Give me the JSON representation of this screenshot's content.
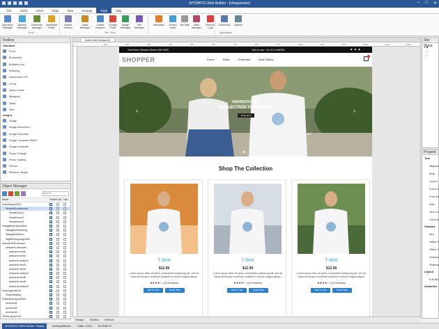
{
  "app": {
    "title": "WYSIWYG Web Builder - [shopperwire]"
  },
  "menu": [
    "File",
    "Home",
    "Insert",
    "Page",
    "View",
    "Arrange",
    "Tools",
    "Help"
  ],
  "menu_active": "Tools",
  "ribbon": {
    "buttons": [
      {
        "label": "Animation Manager",
        "color": "#5a88c6"
      },
      {
        "label": "Backup Manager",
        "color": "#4aa6d8"
      },
      {
        "label": "Extension Manager",
        "color": "#6a8a3a"
      },
      {
        "label": "JavaScript Editor",
        "color": "#d9a021"
      },
      {
        "label": "Master Frames",
        "color": "#7a7ab0"
      },
      {
        "label": "Asset Manager",
        "color": "#c98b2a"
      },
      {
        "label": "Global Replace",
        "color": "#4d88c8"
      },
      {
        "label": "Google Fonts",
        "color": "#d9463a"
      },
      {
        "label": "Image Manager",
        "color": "#3a9a5a"
      },
      {
        "label": "Link Manager",
        "color": "#7a5ab0"
      },
      {
        "label": "Inferodule",
        "color": "#e67b2a"
      },
      {
        "label": "Search Index",
        "color": "#4a9ad8"
      },
      {
        "label": "Site Map",
        "color": "#9a9a9a"
      },
      {
        "label": "Style Manager",
        "color": "#b04a6a"
      },
      {
        "label": "Remove Logo",
        "color": "#d84040"
      },
      {
        "label": "Customize",
        "color": "#5a7ab0"
      },
      {
        "label": "Options",
        "color": "#6a8a9a"
      }
    ],
    "groups": [
      "Tools",
      "Site Tools",
      "Application"
    ]
  },
  "toolbox": {
    "title": "Toolbox",
    "sections": [
      {
        "name": "Standard",
        "items": [
          "Form",
          "Bookmark",
          "Bulleted List",
          "Heading",
          "Horizontal Line",
          "HTML",
          "Inline Frame",
          "Marquee",
          "Table",
          "Text"
        ]
      },
      {
        "name": "Images",
        "items": [
          "Image",
          "Image Accordion",
          "Image Carousel",
          "Image Compare Slider",
          "Image Hotspots",
          "Photo Collage",
          "Photo Gallery",
          "Picture",
          "Rollover Image"
        ]
      }
    ]
  },
  "object_manager": {
    "title": "Object Manager",
    "search_placeholder": "Search",
    "columns": [
      "Name",
      "Visible",
      "Lock",
      "Use"
    ],
    "rows": [
      {
        "name": "IndexLayoutGrid",
        "indent": 0
      },
      {
        "name": "HeaderBreadcrumb",
        "indent": 1,
        "selected": true
      },
      {
        "name": "HeaderIcon1",
        "indent": 2
      },
      {
        "name": "HeaderIcon2",
        "indent": 2
      },
      {
        "name": "HeaderIcon3",
        "indent": 2
      },
      {
        "name": "NavigationLayoutGrid",
        "indent": 0
      },
      {
        "name": "NavigationHeading",
        "indent": 1
      },
      {
        "name": "NavigationMenu",
        "indent": 1
      },
      {
        "name": "DigitalShoppingCart1",
        "indent": 1
      },
      {
        "name": "LayoutGridCarousel",
        "indent": 0
      },
      {
        "name": "welcome-carousel",
        "indent": 1
      },
      {
        "name": "welcome-text1",
        "indent": 2
      },
      {
        "name": "welcome-text2",
        "indent": 2
      },
      {
        "name": "welcome-button1",
        "indent": 2
      },
      {
        "name": "welcome-text3",
        "indent": 2
      },
      {
        "name": "welcome-text4",
        "indent": 2
      },
      {
        "name": "welcome-button2",
        "indent": 2
      },
      {
        "name": "welcome-text5",
        "indent": 2
      },
      {
        "name": "welcome-text6",
        "indent": 2
      },
      {
        "name": "welcome-button3",
        "indent": 2
      },
      {
        "name": "ShopLayoutGrid",
        "indent": 0
      },
      {
        "name": "ShopHeading",
        "indent": 1
      },
      {
        "name": "CollectionLayoutGrid",
        "indent": 0
      },
      {
        "name": "iconCard1",
        "indent": 1
      },
      {
        "name": "iconCard2",
        "indent": 1
      },
      {
        "name": "iconCard3",
        "indent": 1
      },
      {
        "name": "TshirtLayoutGrid",
        "indent": 0
      }
    ]
  },
  "document_tab": "index.html (shopper)",
  "ruler_ticks": [
    "100",
    "200",
    "300",
    "400",
    "500",
    "600",
    "700",
    "800",
    "900",
    "1000",
    "1100",
    "1200",
    "1300",
    "1400",
    "1500"
  ],
  "website": {
    "topbar_left": "Visit Store: Meadow Street 4100 9000",
    "topbar_right": "Call us now: +44 012 4496789",
    "logo": "SHOPPER",
    "nav": [
      "Home",
      "News",
      "Collection",
      "Best Sellers"
    ],
    "hero_line1": "INSPIRATIONAL",
    "hero_line2": "COLLECTION TO SEASON",
    "hero_button": "Shop Now",
    "section_title": "Shop The Collection",
    "products": [
      {
        "name": "T-Shirt",
        "price": "$12.99",
        "desc": "Lorem ipsum dolor sit amet, consectetur adipiscing elit, sed do eiusmod tempor incididunt ut labore et dolore magna aliqua.",
        "rating": "★★★★☆ (15 reviews)",
        "cart": "Add To Cart",
        "view": "Quick View"
      },
      {
        "name": "T-Shirt",
        "price": "$12.99",
        "desc": "Lorem ipsum dolor sit amet, consectetur adipiscing elit, sed do eiusmod tempor incididunt ut labore et dolore magna aliqua.",
        "rating": "★★★★☆ (15 reviews)",
        "cart": "Add To Cart",
        "view": "Quick View"
      },
      {
        "name": "T-Shirt",
        "price": "$12.99",
        "desc": "Lorem ipsum dolor sit amet, consectetur adipiscing elit, sed do eiusmod tempor incididunt ut labore et dolore magna aliqua.",
        "rating": "★★★★☆ (15 reviews)",
        "cart": "Add To Cart",
        "view": "Quick View"
      }
    ]
  },
  "site_manager": {
    "title": "Site Mana"
  },
  "properties": {
    "title": "Properti",
    "sections": [
      {
        "name": "Text",
        "items": [
          "Alignment",
          "Bold",
          "Cursor",
          "Font Fam",
          "Font Size",
          "Italic",
          "Text Color",
          "Underline"
        ]
      },
      {
        "name": "Shadow",
        "items": [
          "Blur",
          "Offset X",
          "Offset Y",
          "Shadow",
          "Shadow"
        ]
      },
      {
        "name": "Layout",
        "items": [
          "Full Width"
        ]
      },
      {
        "name": "Underline",
        "items": []
      }
    ]
  },
  "bottom_tabs": [
    "Design",
    "Toolbox",
    "Default"
  ],
  "status": [
    "WYSIWYG Web Builder: Ready",
    "NoScriptButton",
    "1368 x 2022",
    "WYSIWYG"
  ]
}
